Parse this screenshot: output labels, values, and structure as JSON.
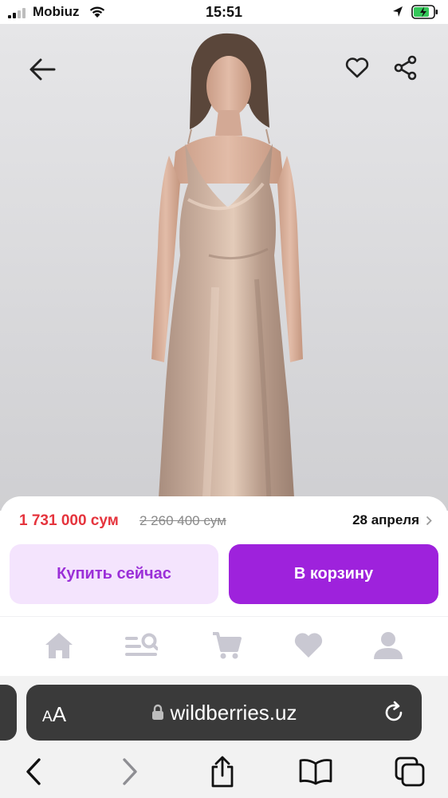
{
  "status_bar": {
    "carrier": "Mobiuz",
    "time": "15:51"
  },
  "product": {
    "price_current": "1 731 000 сум",
    "price_old": "2 260 400 сум",
    "delivery_date": "28 апреля"
  },
  "actions": {
    "buy_now": "Купить сейчас",
    "add_to_cart": "В корзину"
  },
  "bottom_nav": {
    "items": [
      "home-icon",
      "catalog-search-icon",
      "cart-icon",
      "favorites-icon",
      "profile-icon"
    ],
    "icon_color": "#c9c8d2"
  },
  "browser": {
    "url": "wildberries.uz",
    "text_size_label_small": "A",
    "text_size_label_big": "A"
  },
  "colors": {
    "accent": "#9e22dc",
    "accent_light": "#f4e4fd",
    "price": "#e5343d"
  }
}
